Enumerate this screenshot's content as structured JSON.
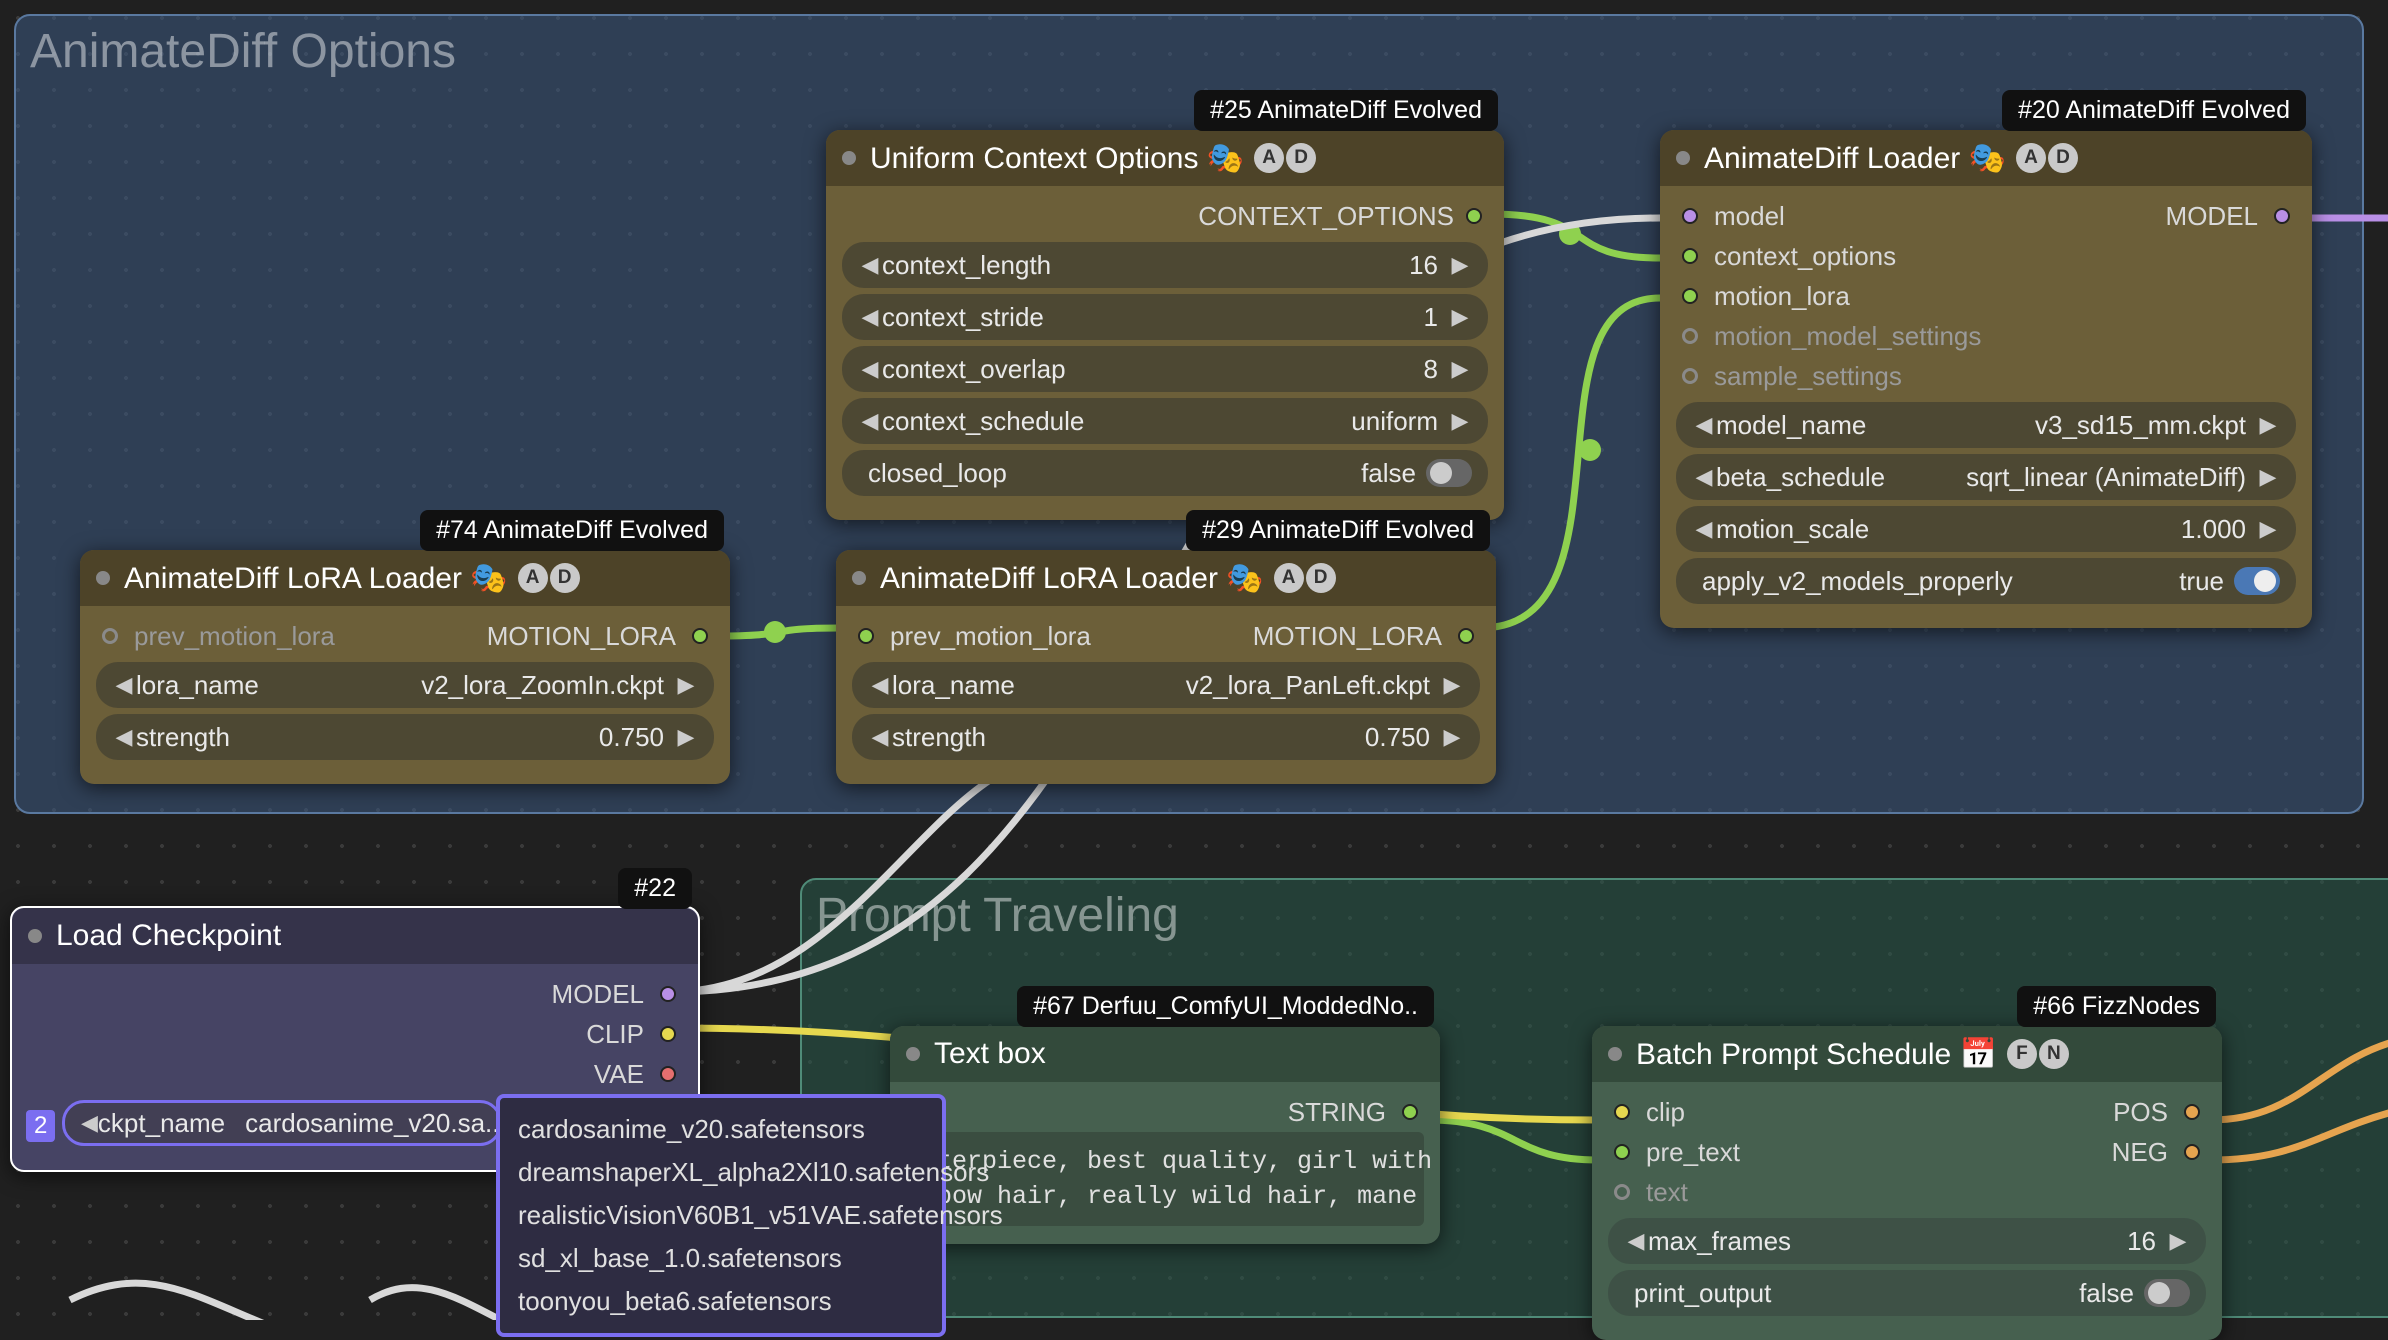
{
  "groups": {
    "animatediff": {
      "title": "AnimateDiff Options"
    },
    "prompt": {
      "title": "Prompt Traveling"
    }
  },
  "nodes": {
    "uco": {
      "tag": "#25 AnimateDiff Evolved",
      "title": "Uniform Context Options 🎭",
      "badges": [
        "A",
        "D"
      ],
      "out": {
        "context_options": "CONTEXT_OPTIONS"
      },
      "widgets": {
        "context_length": {
          "label": "context_length",
          "value": "16"
        },
        "context_stride": {
          "label": "context_stride",
          "value": "1"
        },
        "context_overlap": {
          "label": "context_overlap",
          "value": "8"
        },
        "context_schedule": {
          "label": "context_schedule",
          "value": "uniform"
        },
        "closed_loop": {
          "label": "closed_loop",
          "value": "false"
        }
      }
    },
    "adl": {
      "tag": "#20 AnimateDiff Evolved",
      "title": "AnimateDiff Loader 🎭",
      "badges": [
        "A",
        "D"
      ],
      "in": {
        "model": "model",
        "context_options": "context_options",
        "motion_lora": "motion_lora",
        "motion_model_settings": "motion_model_settings",
        "sample_settings": "sample_settings"
      },
      "out": {
        "model": "MODEL"
      },
      "widgets": {
        "model_name": {
          "label": "model_name",
          "value": "v3_sd15_mm.ckpt"
        },
        "beta_schedule": {
          "label": "beta_schedule",
          "value": "sqrt_linear (AnimateDiff)"
        },
        "motion_scale": {
          "label": "motion_scale",
          "value": "1.000"
        },
        "apply_v2": {
          "label": "apply_v2_models_properly",
          "value": "true"
        }
      }
    },
    "lora74": {
      "tag": "#74 AnimateDiff Evolved",
      "title": "AnimateDiff LoRA Loader 🎭",
      "badges": [
        "A",
        "D"
      ],
      "in": {
        "prev": "prev_motion_lora"
      },
      "out": {
        "ml": "MOTION_LORA"
      },
      "widgets": {
        "lora_name": {
          "label": "lora_name",
          "value": "v2_lora_ZoomIn.ckpt"
        },
        "strength": {
          "label": "strength",
          "value": "0.750"
        }
      }
    },
    "lora29": {
      "tag": "#29 AnimateDiff Evolved",
      "title": "AnimateDiff LoRA Loader 🎭",
      "badges": [
        "A",
        "D"
      ],
      "in": {
        "prev": "prev_motion_lora"
      },
      "out": {
        "ml": "MOTION_LORA"
      },
      "widgets": {
        "lora_name": {
          "label": "lora_name",
          "value": "v2_lora_PanLeft.ckpt"
        },
        "strength": {
          "label": "strength",
          "value": "0.750"
        }
      }
    },
    "load22": {
      "tag": "#22",
      "title": "Load Checkpoint",
      "out": {
        "model": "MODEL",
        "clip": "CLIP",
        "vae": "VAE"
      },
      "widgets": {
        "ckpt_name": {
          "label": "ckpt_name",
          "value": "cardosanime_v20.sa..."
        }
      }
    },
    "textbox": {
      "tag": "#67 Derfuu_ComfyUI_ModdedNo..",
      "title": "Text box",
      "out": {
        "string": "STRING"
      },
      "text": "sterpiece, best quality, girl with\nnbow hair, really wild hair, mane"
    },
    "bps": {
      "tag": "#66 FizzNodes",
      "title": "Batch Prompt Schedule 📅",
      "badges": [
        "F",
        "N"
      ],
      "in": {
        "clip": "clip",
        "pre_text": "pre_text",
        "text": "text"
      },
      "out": {
        "pos": "POS",
        "neg": "NEG"
      },
      "widgets": {
        "max_frames": {
          "label": "max_frames",
          "value": "16"
        },
        "print_output": {
          "label": "print_output",
          "value": "false"
        }
      }
    }
  },
  "dropdown": {
    "edit_index": "2",
    "options": [
      "cardosanime_v20.safetensors",
      "dreamshaperXL_alpha2Xl10.safetensors",
      "realisticVisionV60B1_v51VAE.safetensors",
      "sd_xl_base_1.0.safetensors",
      "toonyou_beta6.safetensors"
    ]
  }
}
